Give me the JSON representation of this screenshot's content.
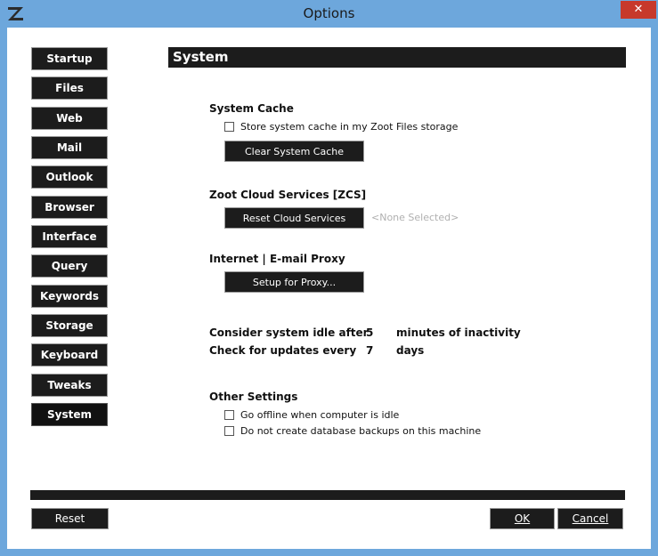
{
  "window": {
    "title": "Options",
    "close_glyph": "✕"
  },
  "sidebar": {
    "items": [
      {
        "label": "Startup"
      },
      {
        "label": "Files"
      },
      {
        "label": "Web"
      },
      {
        "label": "Mail"
      },
      {
        "label": "Outlook"
      },
      {
        "label": "Browser"
      },
      {
        "label": "Interface"
      },
      {
        "label": "Query"
      },
      {
        "label": "Keywords"
      },
      {
        "label": "Storage"
      },
      {
        "label": "Keyboard"
      },
      {
        "label": "Tweaks"
      },
      {
        "label": "System"
      }
    ],
    "active": "System"
  },
  "content": {
    "header": "System",
    "system_cache": {
      "heading": "System Cache",
      "checkbox_label": "Store system cache in my Zoot Files storage",
      "checkbox_checked": false,
      "button_label": "Clear System Cache"
    },
    "cloud": {
      "heading": "Zoot Cloud Services [ZCS]",
      "button_label": "Reset Cloud Services",
      "status": "<None Selected>"
    },
    "proxy": {
      "heading": "Internet | E-mail Proxy",
      "button_label": "Setup for Proxy..."
    },
    "idle": {
      "label": "Consider system idle after",
      "value": "5",
      "suffix": "minutes of inactivity"
    },
    "updates": {
      "label": "Check for updates every",
      "value": "7",
      "suffix": "days"
    },
    "other": {
      "heading": "Other Settings",
      "offline_label": "Go offline when computer is idle",
      "offline_checked": false,
      "backups_label": "Do not create database backups on this machine",
      "backups_checked": false
    }
  },
  "footer": {
    "reset_label": "Reset",
    "ok_label": "OK",
    "cancel_label": "Cancel"
  },
  "colors": {
    "frame": "#6da7dc",
    "panel_dark": "#1c1c1c",
    "close_red": "#c7392b"
  }
}
